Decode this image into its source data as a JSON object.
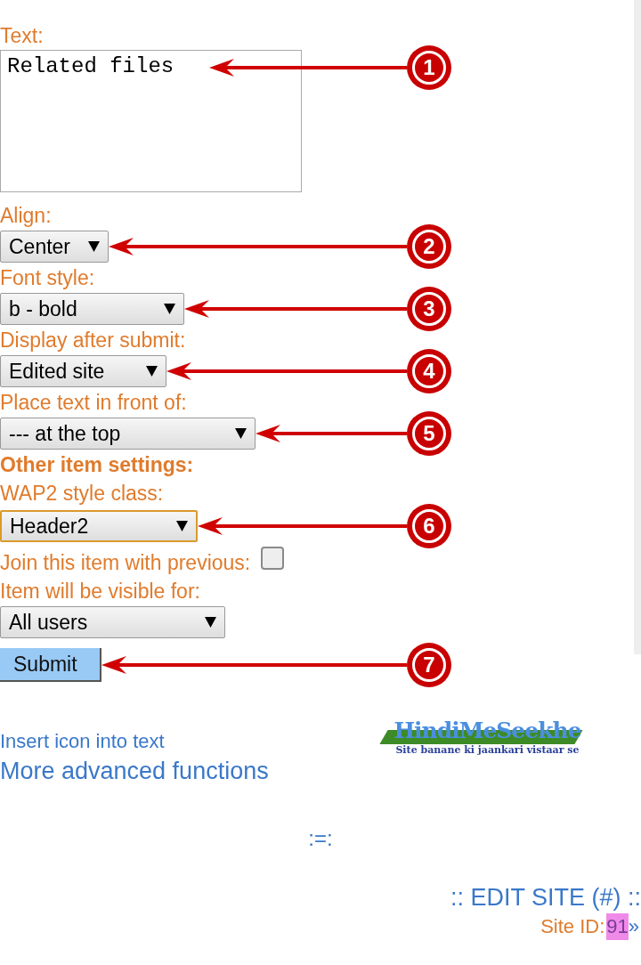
{
  "text_field": {
    "label": "Text:",
    "value": "Related files",
    "callout": "1"
  },
  "form_items": [
    {
      "kind": "select",
      "label": "Align:",
      "value": "Center",
      "focused": false,
      "callout": "2"
    },
    {
      "kind": "select",
      "label": "Font style:",
      "value": "b - bold",
      "focused": false,
      "callout": "3"
    },
    {
      "kind": "select",
      "label": "Display after submit:",
      "value": "Edited site",
      "focused": false,
      "callout": "4"
    },
    {
      "kind": "select",
      "label": "Place text in front of:",
      "value": "--- at the top",
      "focused": false,
      "callout": "5"
    },
    {
      "kind": "heading",
      "label": "Other item settings:"
    },
    {
      "kind": "select",
      "label": "WAP2 style class:",
      "value": "Header2",
      "focused": true,
      "callout": "6"
    },
    {
      "kind": "checkbox",
      "label": "Join this item with previous:",
      "checked": false
    },
    {
      "kind": "select",
      "label": "Item will be visible for:",
      "value": "All users",
      "focused": false
    }
  ],
  "submit": {
    "label": "Submit",
    "callout": "7"
  },
  "links": [
    "Insert icon into text",
    "More advanced functions"
  ],
  "logo": {
    "title": "HindiMeSeekhe",
    "tagline": "Site banane ki jaankari vistaar se"
  },
  "separator": ":=:",
  "footer": {
    "edit_link": ":: EDIT SITE (#) ::",
    "site_id_label": "Site ID:",
    "site_id": "91",
    "next_link": "»"
  }
}
